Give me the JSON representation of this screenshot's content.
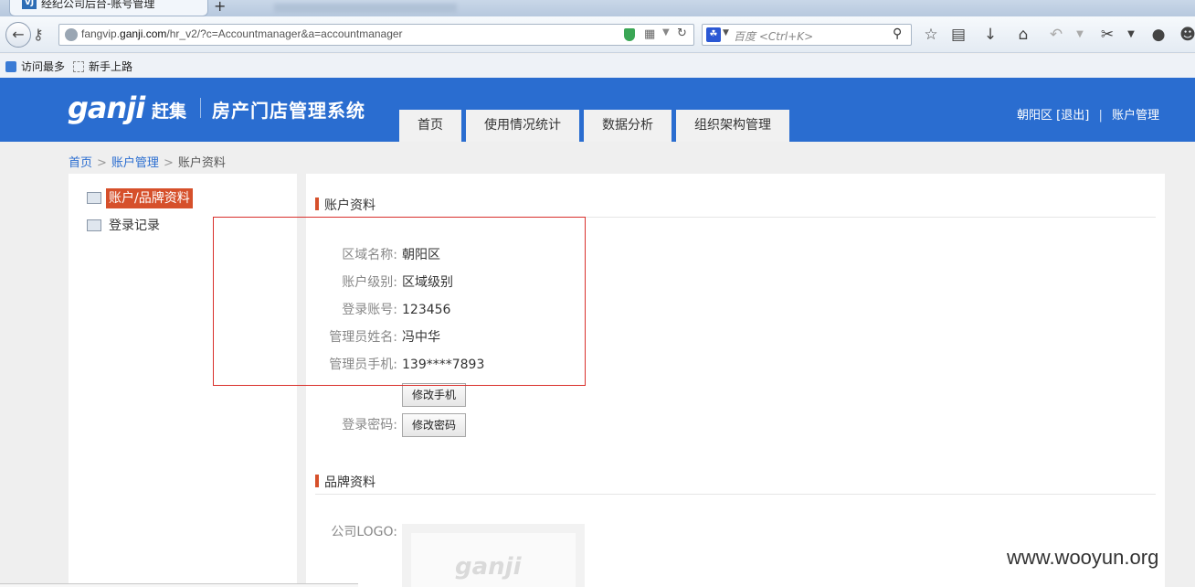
{
  "browser": {
    "tab_title": "经纪公司后台-账号管理",
    "tab_favicon_text": "VJ",
    "new_tab_label": "+",
    "url_prefix": "fangvip.",
    "url_domain": "ganji.com",
    "url_path": "/hr_v2/?c=Accountmanager&a=accountmanager",
    "search_placeholder": "百度 <Ctrl+K>",
    "bookmarks": [
      "访问最多",
      "新手上路"
    ]
  },
  "header": {
    "logo_text": "ganji",
    "logo_cn": "赶集",
    "system_title": "房产门店管理系统",
    "nav": [
      "首页",
      "使用情况统计",
      "数据分析",
      "组织架构管理"
    ],
    "user_area": "朝阳区",
    "logout_label": "[退出]",
    "account_link": "账户管理",
    "separator": "|"
  },
  "breadcrumb": {
    "home": "首页",
    "account_manage": "账户管理",
    "current": "账户资料",
    "arrow": ">"
  },
  "sidebar": {
    "items": [
      {
        "label": "账户/品牌资料",
        "active": true
      },
      {
        "label": "登录记录",
        "active": false
      }
    ]
  },
  "account": {
    "section_title": "账户资料",
    "fields": [
      {
        "label": "区域名称:",
        "value": "朝阳区"
      },
      {
        "label": "账户级别:",
        "value": "区域级别"
      },
      {
        "label": "登录账号:",
        "value": "123456"
      },
      {
        "label": "管理员姓名:",
        "value": "冯中华"
      },
      {
        "label": "管理员手机:",
        "value": "139****7893"
      }
    ],
    "change_phone_button": "修改手机",
    "password_label": "登录密码:",
    "change_password_button": "修改密码"
  },
  "brand": {
    "section_title": "品牌资料",
    "logo_label": "公司LOGO:",
    "logo_placeholder": "ganji"
  },
  "watermark": "www.wooyun.org",
  "colors": {
    "header_blue": "#2a6dd0",
    "accent_red": "#d6502b",
    "highlight_red": "#d9302c"
  }
}
